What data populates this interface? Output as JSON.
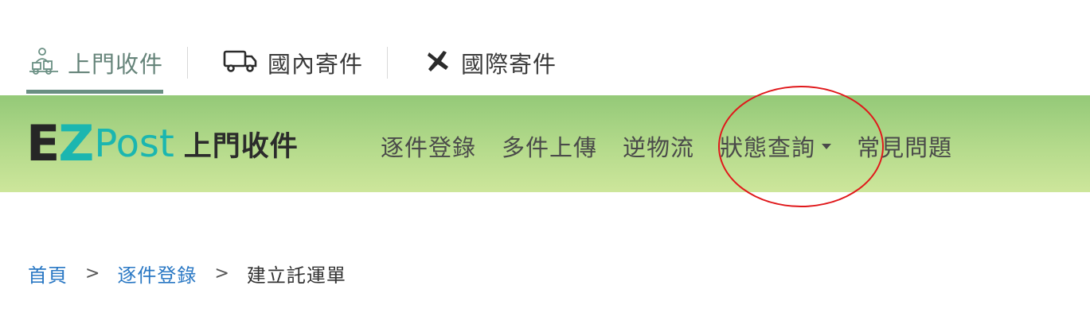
{
  "service_tabs": [
    {
      "label": "上門收件",
      "icon": "courier-person-icon",
      "active": true
    },
    {
      "label": "國內寄件",
      "icon": "truck-icon",
      "active": false
    },
    {
      "label": "國際寄件",
      "icon": "airplane-icon",
      "active": false
    }
  ],
  "logo": {
    "ez_e": "E",
    "ez_z": "Z",
    "post": "Post",
    "subtitle": "上門收件"
  },
  "nav": {
    "items": [
      {
        "label": "逐件登錄"
      },
      {
        "label": "多件上傳"
      },
      {
        "label": "逆物流"
      },
      {
        "label": "狀態查詢",
        "has_dropdown": true
      },
      {
        "label": "常見問題"
      }
    ]
  },
  "breadcrumb": {
    "home": "首頁",
    "separator": ">",
    "section": "逐件登錄",
    "current": "建立託運單"
  },
  "colors": {
    "brand_teal": "#1bb6b0",
    "header_green_top": "#94c978",
    "header_green_bottom": "#cde69b",
    "active_tab": "#66847a",
    "link_blue": "#2a78c4",
    "annotation_red": "#e0181b"
  }
}
